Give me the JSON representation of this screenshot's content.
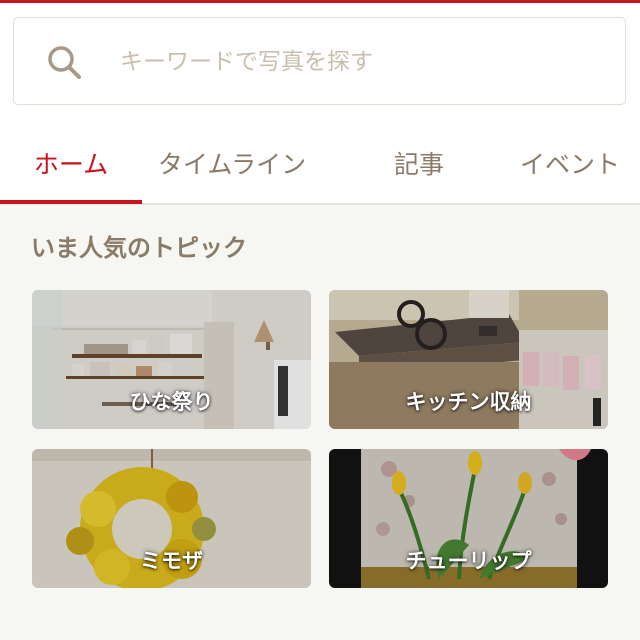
{
  "search": {
    "placeholder": "キーワードで写真を探す",
    "value": ""
  },
  "tabs": [
    {
      "label": "ホーム",
      "active": true
    },
    {
      "label": "タイムライン",
      "active": false
    },
    {
      "label": "記事",
      "active": false
    },
    {
      "label": "イベント",
      "active": false
    }
  ],
  "section": {
    "title": "いま人気のトピック"
  },
  "topics": [
    {
      "label": "ひな祭り"
    },
    {
      "label": "キッチン収納"
    },
    {
      "label": "ミモザ"
    },
    {
      "label": "チューリップ"
    }
  ],
  "colors": {
    "accent": "#c8141c",
    "tab_inactive": "#8a7a68",
    "placeholder": "#c9bfae",
    "background": "#f6f6f2"
  }
}
